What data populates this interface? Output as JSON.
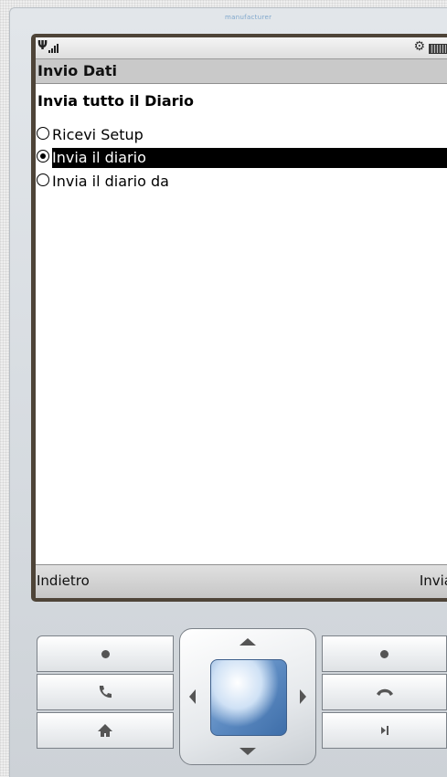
{
  "brand": "manufacturer",
  "status_bar": {
    "signal_icon": "antenna-signal-icon",
    "settings_icon": "gear-icon",
    "battery_icon": "battery-icon"
  },
  "title": "Invio Dati",
  "heading": "Invia tutto il Diario",
  "options": [
    {
      "label": "Ricevi Setup",
      "selected": false
    },
    {
      "label": "Invia il diario",
      "selected": true
    },
    {
      "label": "Invia il diario da",
      "selected": false
    }
  ],
  "softkeys": {
    "left": "Indietro",
    "right": "Invia"
  },
  "keypad": {
    "left_select_icon": "dot-icon",
    "call_icon": "phone-handset-icon",
    "home_icon": "home-icon",
    "right_select_icon": "dot-icon",
    "end_call_icon": "hangup-icon",
    "back_icon": "back-arrow-icon"
  }
}
